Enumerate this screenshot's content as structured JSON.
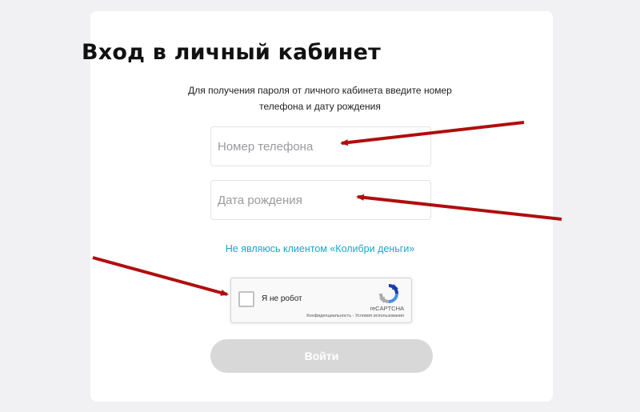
{
  "login": {
    "title": "Вход в личный кабинет",
    "subtitle_line1": "Для получения пароля от личного кабинета введите номер",
    "subtitle_line2": "телефона и дату рождения",
    "phone_placeholder": "Номер телефона",
    "phone_value": "",
    "dob_placeholder": "Дата рождения",
    "dob_value": "",
    "not_client_link": "Не являюсь клиентом «Колибри деньги»",
    "submit_label": "Войти"
  },
  "captcha": {
    "label": "Я не робот",
    "brand": "reCAPTCHA",
    "terms": "Конфиденциальность - Условия использования",
    "icon": "recaptcha-logo"
  },
  "annotations": {
    "arrow_color": "#b00e0e"
  },
  "colors": {
    "background": "#f1f1f3",
    "card": "#ffffff",
    "link": "#1aa6cf",
    "button_disabled": "#d8d8d8"
  }
}
